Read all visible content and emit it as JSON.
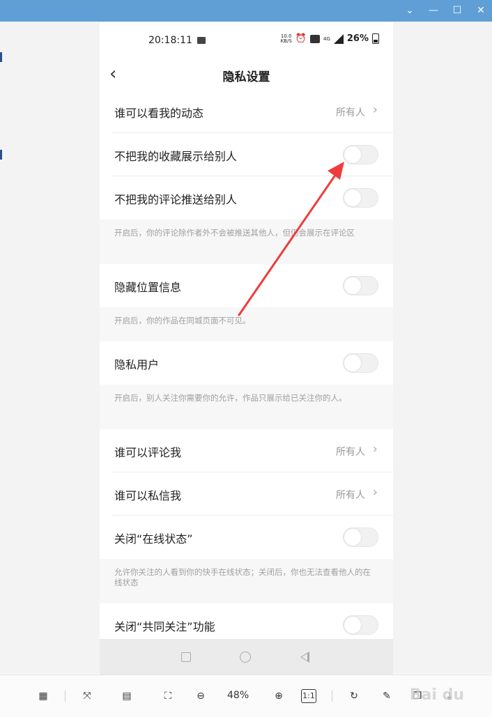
{
  "status_bar": {
    "time": "20:18:11",
    "speed": "10.0",
    "speed_unit": "KB/S",
    "network": "4G",
    "battery": "26%"
  },
  "nav": {
    "title": "隐私设置"
  },
  "settings": [
    {
      "label": "谁可以看我的动态",
      "value": "所有人"
    },
    {
      "label": "不把我的收藏展示给别人"
    },
    {
      "label": "不把我的评论推送给别人"
    },
    {
      "note": "开启后，你的评论除作者外不会被推送其他人，但仍会展示在评论区"
    },
    {
      "label": "隐藏位置信息"
    },
    {
      "note": "开启后，你的作品在同城页面不可见。"
    },
    {
      "label": "隐私用户"
    },
    {
      "note": "开启后，别人关注你需要你的允许，作品只展示给已关注你的人。"
    },
    {
      "label": "谁可以评论我",
      "value": "所有人"
    },
    {
      "label": "谁可以私信我",
      "value": "所有人"
    },
    {
      "label": "关闭“在线状态”"
    },
    {
      "note": "允许你关注的人看到你的快手在线状态；关闭后，你也无法查看他人的在线状态"
    },
    {
      "label": "关闭“共同关注”功能"
    }
  ],
  "viewer": {
    "zoom": "48%",
    "actual_size_label": "1:1"
  },
  "colors": {
    "accent": "#5f9fd6",
    "arrow": "#ef3b3b"
  }
}
